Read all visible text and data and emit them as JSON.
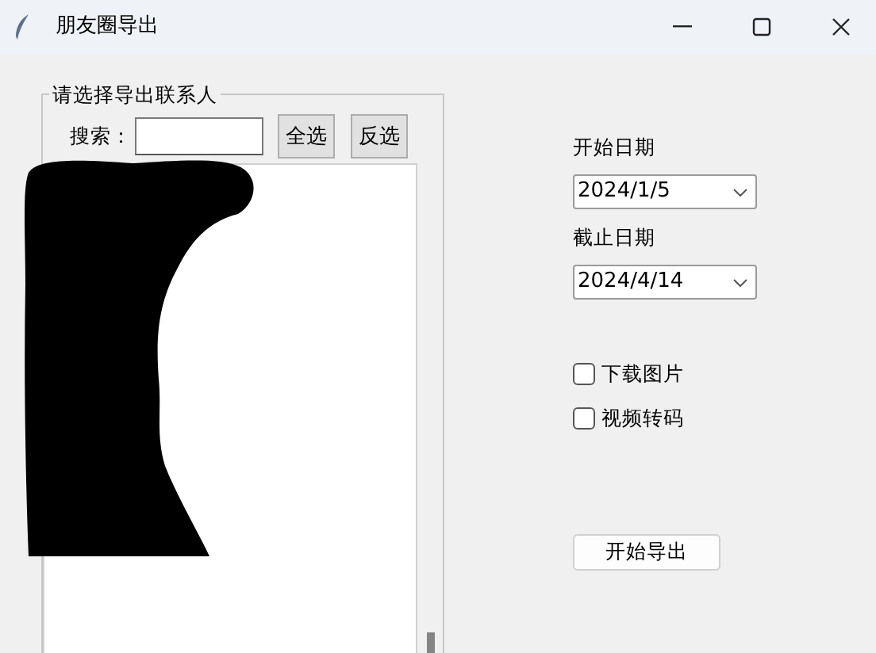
{
  "window": {
    "title": "朋友圈导出"
  },
  "contact_frame": {
    "title": "请选择导出联系人",
    "search_label": "搜索：",
    "buttons": [
      {
        "label": "全选"
      },
      {
        "label": "反选"
      }
    ],
    "redacted": true
  },
  "dates": [
    {
      "label": "开始日期",
      "value": "2024/1/5"
    },
    {
      "label": "截止日期",
      "value": "2024/4/14"
    }
  ],
  "options": [
    {
      "label": "下载图片",
      "checked": false
    },
    {
      "label": "视频转码",
      "checked": false
    }
  ],
  "export_button": {
    "label": "开始导出"
  }
}
